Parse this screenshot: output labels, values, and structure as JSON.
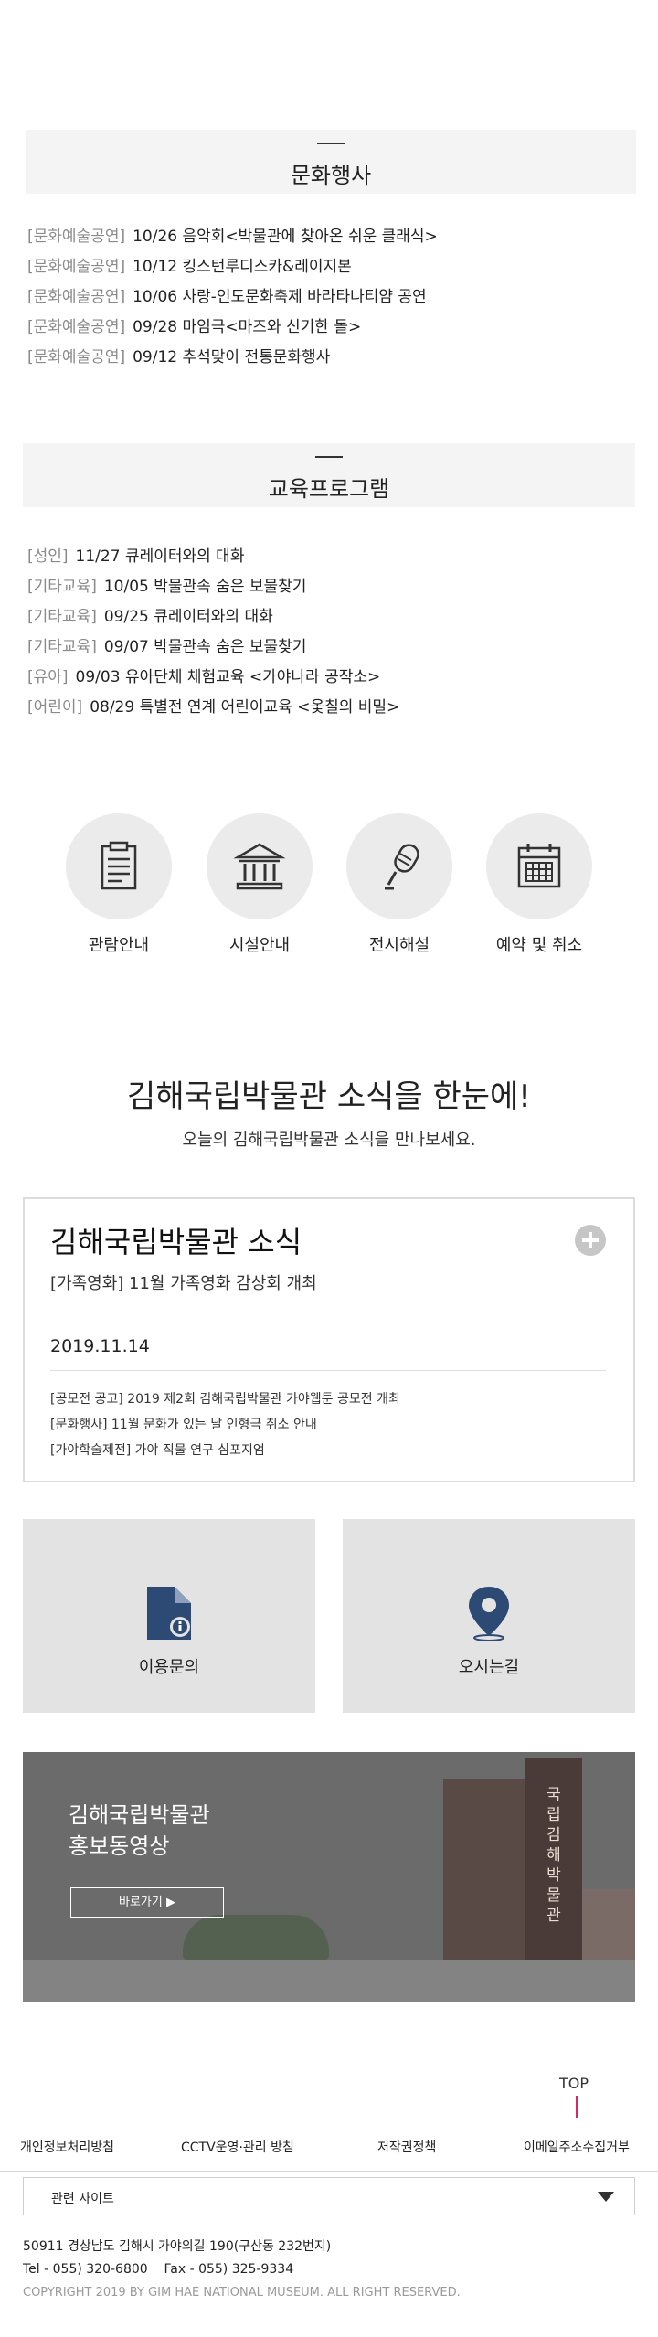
{
  "culture": {
    "title": "문화행사",
    "items": [
      {
        "category": "[문화예술공연]",
        "text": "10/26 음악회<박물관에 찾아온 쉬운 클래식>"
      },
      {
        "category": "[문화예술공연]",
        "text": "10/12 킹스턴루디스카&레이지본"
      },
      {
        "category": "[문화예술공연]",
        "text": "10/06 사랑-인도문화축제 바라타나티얌 공연"
      },
      {
        "category": "[문화예술공연]",
        "text": "09/28 마임극<마즈와 신기한 돌>"
      },
      {
        "category": "[문화예술공연]",
        "text": "09/12 추석맞이 전통문화행사"
      }
    ]
  },
  "education": {
    "title": "교육프로그램",
    "items": [
      {
        "category": "[성인]",
        "text": "11/27 큐레이터와의 대화"
      },
      {
        "category": "[기타교육]",
        "text": "10/05 박물관속 숨은 보물찾기"
      },
      {
        "category": "[기타교육]",
        "text": "09/25 큐레이터와의 대화"
      },
      {
        "category": "[기타교육]",
        "text": "09/07 박물관속 숨은 보물찾기"
      },
      {
        "category": "[유아]",
        "text": "09/03 유아단체 체험교육 <가야나라 공작소>"
      },
      {
        "category": "[어린이]",
        "text": "08/29 특별전 연계 어린이교육 <옻칠의 비밀>"
      }
    ]
  },
  "quick_menu": [
    {
      "label": "관람안내",
      "icon": "clipboard-icon"
    },
    {
      "label": "시설안내",
      "icon": "museum-building-icon"
    },
    {
      "label": "전시해설",
      "icon": "microphone-icon"
    },
    {
      "label": "예약 및 취소",
      "icon": "calendar-icon"
    }
  ],
  "news_section": {
    "title": "김해국립박물관 소식을 한눈에!",
    "subtitle": "오늘의 김해국립박물관 소식을 만나보세요."
  },
  "news_box": {
    "heading": "김해국립박물관 소식",
    "lead": "[가족영화] 11월 가족영화 감상회 개최",
    "date": "2019.11.14",
    "items": [
      "[공모전 공고] 2019 제2회 김해국립박물관 가야웹툰 공모전 개최",
      "[문화행사] 11월 문화가 있는 날 인형극 취소 안내",
      "[가야학술제전] 가야 직물 연구 심포지엄"
    ]
  },
  "tiles": {
    "inquiry": {
      "label": "이용문의",
      "icon": "document-info-icon"
    },
    "directions": {
      "label": "오시는길",
      "icon": "location-pin-icon"
    }
  },
  "promo": {
    "title_line1": "김해국립박물관",
    "title_line2": "홍보동영상",
    "button": "바로가기 ▶",
    "building_sign": "국립김해박물관"
  },
  "top_button": "TOP",
  "footer": {
    "links": [
      "개인정보처리방침",
      "CCTV운영·관리 방침",
      "저작권정책",
      "이메일주소수집거부"
    ],
    "related_sites": "관련 사이트",
    "address": "50911 경상남도 김해시 가야의길 190(구산동 232번지)",
    "tel": "Tel - 055) 320-6800",
    "fax": "Fax - 055) 325-9334",
    "copyright": "COPYRIGHT 2019 BY GIM HAE NATIONAL MUSEUM. ALL RIGHT RESERVED."
  },
  "colors": {
    "accent": "#d42a5d",
    "tile_bg": "#e3e3e3",
    "icon_blue": "#2d4a74"
  }
}
